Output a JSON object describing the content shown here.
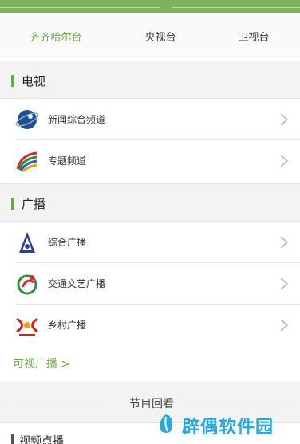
{
  "tabs": [
    {
      "label": "齐齐哈尔台",
      "active": true
    },
    {
      "label": "央视台",
      "active": false
    },
    {
      "label": "卫视台",
      "active": false
    }
  ],
  "tv": {
    "title": "电视",
    "items": [
      {
        "label": "新闻综合频道",
        "icon": "news-channel-logo-icon"
      },
      {
        "label": "专题频道",
        "icon": "special-channel-logo-icon"
      }
    ]
  },
  "radio": {
    "title": "广播",
    "items": [
      {
        "label": "综合广播",
        "icon": "comprehensive-radio-logo-icon"
      },
      {
        "label": "交通文艺广播",
        "icon": "traffic-radio-logo-icon"
      },
      {
        "label": "乡村广播",
        "icon": "rural-radio-logo-icon"
      }
    ]
  },
  "more_link": "可视广播 >",
  "replay_divider": "节目回看",
  "bottom_section": "视频点播",
  "watermark": "辟偶软件园",
  "colors": {
    "accent": "#6aab45",
    "topbar": "#7db25a",
    "watermark": "#2aa8d8"
  }
}
